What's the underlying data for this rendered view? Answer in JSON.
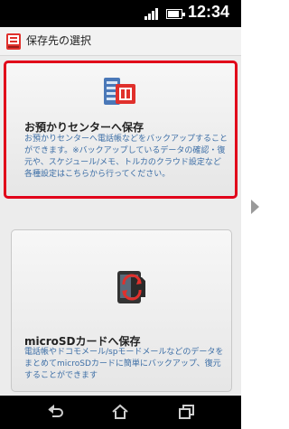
{
  "status_bar": {
    "time": "12:34",
    "icons": [
      "signal-icon",
      "battery-icon"
    ]
  },
  "header": {
    "title": "保存先の選択",
    "icon": "app-icon"
  },
  "options": [
    {
      "title": "お預かりセンターへ保存",
      "icon": "server-book-icon",
      "description": "お預かりセンターへ電話帳などをバックアップすることができます。※バックアップしているデータの確認・復元や、スケジュール/メモ、トルカのクラウド設定など各種設定はこちらから行ってください。",
      "selected": true
    },
    {
      "title": "microSDカードへ保存",
      "icon": "sdcard-sync-icon",
      "description": "電話帳やドコモメール/spモードメールなどのデータをまとめてmicroSDカードに簡単にバックアップ、復元することができます",
      "selected": false
    }
  ],
  "nav_bar": {
    "buttons": [
      "back-icon",
      "home-icon",
      "recent-apps-icon"
    ]
  },
  "colors": {
    "highlight": "#e1001a",
    "description_text": "#3c6ea6",
    "status_bar_bg": "#000000"
  }
}
